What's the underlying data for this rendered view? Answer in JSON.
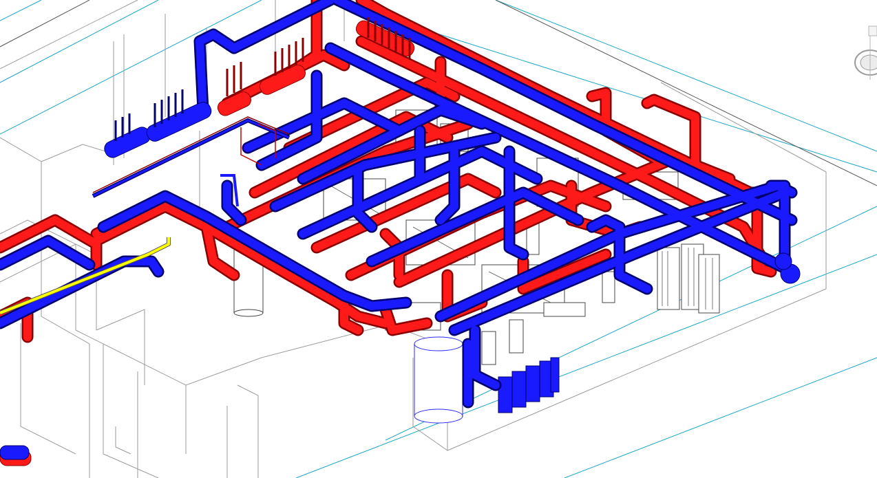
{
  "viewport": {
    "view_name": "",
    "background": "#ffffff"
  },
  "colors": {
    "supply_pipe": "#ff1a1a",
    "return_pipe": "#1a1aff",
    "gas_pipe": "#ffff00",
    "grid_line": "#1aa7c9",
    "wall_line": "#9a9a9a"
  },
  "icons": {
    "view_cube": "viewcube-icon"
  }
}
